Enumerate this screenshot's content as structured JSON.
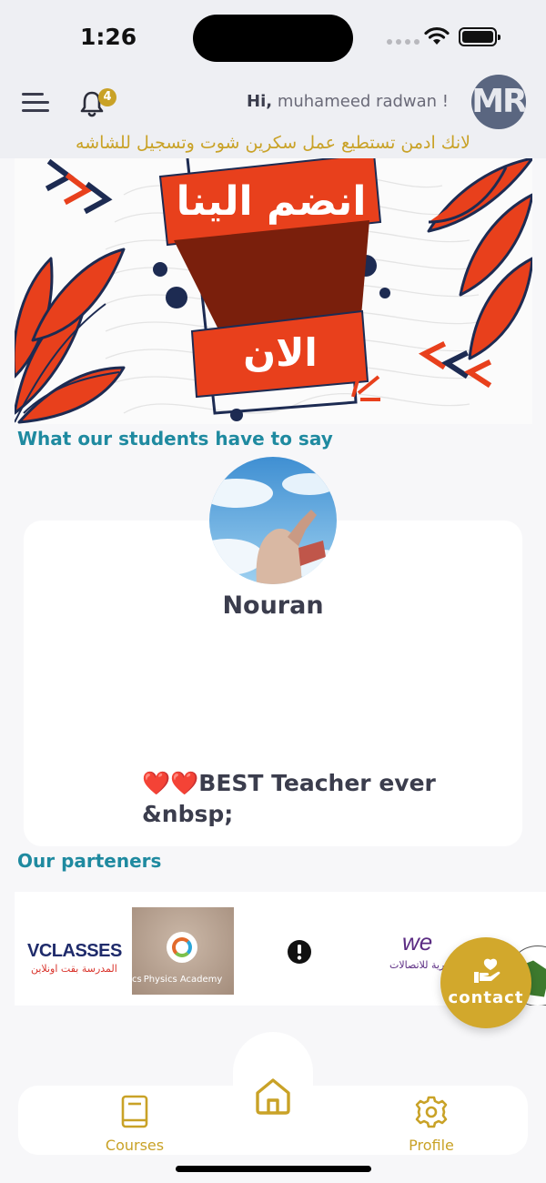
{
  "status_bar": {
    "time": "1:26"
  },
  "header": {
    "notification_count": "4",
    "greeting_prefix": "Hi,",
    "user_name": "muhameed radwan !",
    "avatar_initials": "MR",
    "admin_notice": "لانك ادمن تستطيع عمل سكرين شوت وتسجيل للشاشه"
  },
  "banner": {
    "line1": "انضم الينا",
    "line2": "الان"
  },
  "testimonials": {
    "section_title": "What our students have to say",
    "student_name": "Nouran",
    "review_hearts": "❤️❤️",
    "review_text": "BEST Teacher ever",
    "review_tail": "&nbsp;"
  },
  "partners": {
    "section_title": "Our parteners",
    "items": [
      {
        "name": "VCLASSES",
        "subtitle": "المدرسة بقت اونلاين"
      },
      {
        "name": "Physics Academy",
        "cut_text": "cs"
      },
      {
        "name": ""
      },
      {
        "name": "we",
        "subtitle": "المصرية للاتصالات"
      }
    ]
  },
  "contact": {
    "label": "contact"
  },
  "bottom_nav": {
    "courses_label": "Courses",
    "profile_label": "Profile"
  },
  "colors": {
    "accent_gold": "#c9a227",
    "teal_heading": "#1f8aa0",
    "banner_red": "#e8401c",
    "banner_navy": "#1d2b52"
  },
  "icons": [
    "wifi-icon",
    "battery-icon",
    "menu-icon",
    "bell-icon",
    "book-icon",
    "home-icon",
    "gear-icon",
    "heart-hand-icon",
    "alert-icon"
  ]
}
